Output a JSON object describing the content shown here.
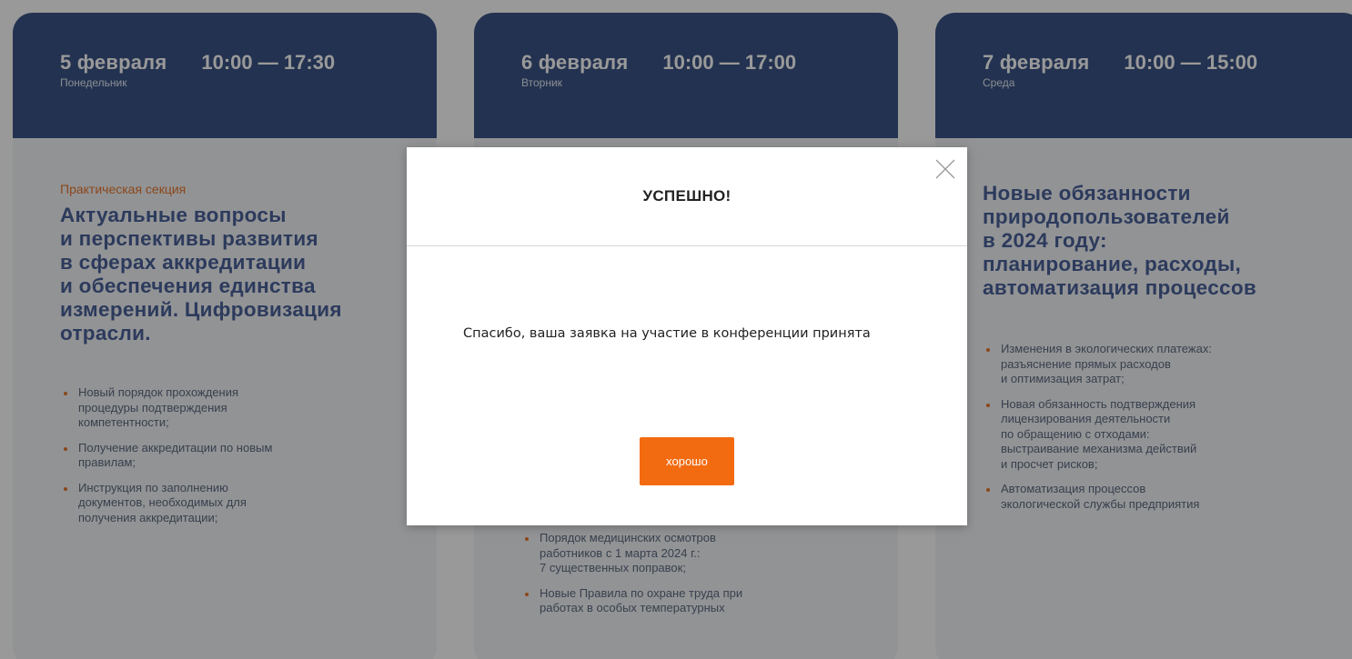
{
  "days": [
    {
      "date": "5 февраля",
      "time": "10:00 — 17:30",
      "weekday": "Понедельник",
      "section_type": "Практическая секция",
      "title_lines": [
        "Актуальные вопросы",
        "и перспективы развития",
        "в сферах аккредитации",
        "и обеспечения единства",
        "измерений. Цифровизация",
        "отрасли."
      ],
      "bullets": [
        [
          "Новый порядок прохождения",
          "процедуры подтверждения",
          "компетентности;"
        ],
        [
          "Получение аккредитации по новым",
          "правилам;"
        ],
        [
          "Инструкция по заполнению",
          "документов, необходимых для",
          "получения аккредитации;"
        ]
      ]
    },
    {
      "date": "6 февраля",
      "time": "10:00 — 17:00",
      "weekday": "Вторник",
      "bullets": [
        [
          "Порядок медицинских осмотров",
          "работников с 1 марта 2024 г.:",
          "7 существенных поправок;"
        ],
        [
          "Новые Правила по охране труда при",
          "работах в особых температурных"
        ]
      ]
    },
    {
      "date": "7 февраля",
      "time": "10:00 — 15:00",
      "weekday": "Среда",
      "title_lines": [
        "Новые обязанности",
        "природопользователей",
        "в 2024 году:",
        "планирование, расходы,",
        "автоматизация процессов"
      ],
      "bullets": [
        [
          "Изменения в экологических платежах:",
          "разъяснение прямых расходов",
          "и оптимизация затрат;"
        ],
        [
          "Новая обязанность подтверждения",
          "лицензирования деятельности",
          "по обращению с отходами:",
          "выстраивание механизма действий",
          "и просчет рисков;"
        ],
        [
          "Автоматизация процессов",
          "экологической службы предприятия"
        ]
      ]
    }
  ],
  "modal": {
    "title": "УСПЕШНО!",
    "message": "Спасибо, ваша заявка на участие в конференции принята",
    "ok_label": "хорошо",
    "close_icon": "close-icon"
  },
  "colors": {
    "header_blue": "#3b5486",
    "title_blue": "#4a6299",
    "accent_orange": "#f26b11",
    "overlay": "rgba(0,0,0,0.4)"
  }
}
